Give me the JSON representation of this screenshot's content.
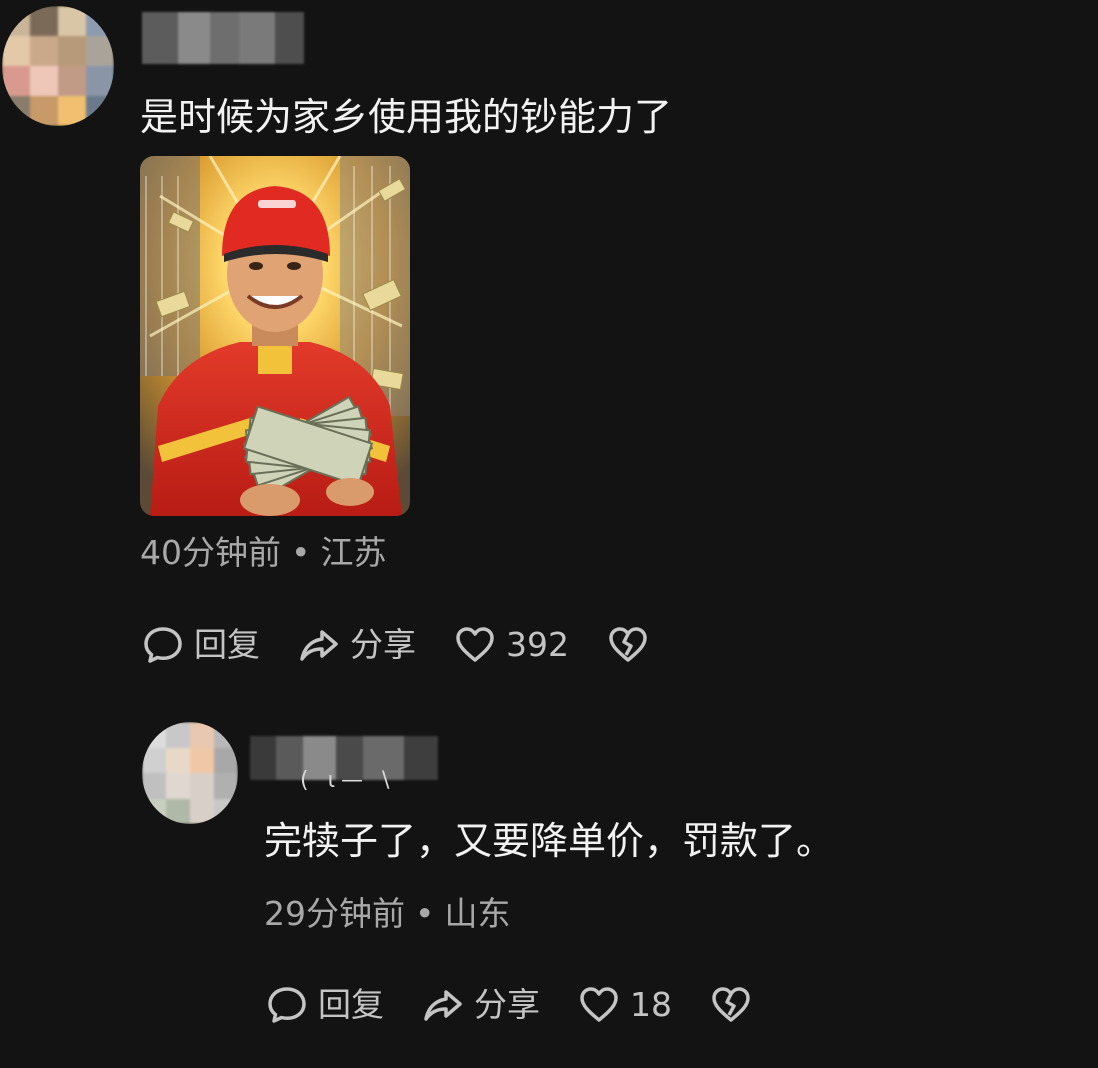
{
  "comments": [
    {
      "text": "是时候为家乡使用我的钞能力了",
      "time": "40分钟前",
      "location": "江苏",
      "actions": {
        "reply": "回复",
        "share": "分享",
        "likes": "392"
      },
      "attachment": {
        "icon": "photo-image",
        "description": "delivery rider in red helmet and uniform holding a fan of cash"
      },
      "avatar_colors": [
        "#c8b59a",
        "#7c6a58",
        "#d9c6a6",
        "#8c9bb0",
        "#e3c9a8",
        "#c9a98a",
        "#b79a7a",
        "#a9a39a",
        "#d89a8e",
        "#efc7b9",
        "#c29b86",
        "#8a96a8",
        "#8a7c6a",
        "#c79a68",
        "#f0c070",
        "#6a7a8c"
      ]
    },
    {
      "text": "完犊子了，又要降单价，罚款了。",
      "time": "29分钟前",
      "location": "山东",
      "actions": {
        "reply": "回复",
        "share": "分享",
        "likes": "18"
      },
      "avatar_colors": [
        "#dcdcdc",
        "#c8c8c8",
        "#e8c8b0",
        "#b8b8b8",
        "#d0d0d0",
        "#e8d8c8",
        "#f0c8a8",
        "#a8a8a8",
        "#c0c0c0",
        "#e0d8d0",
        "#d8d0c8",
        "#b0b0b0",
        "#c8d0c0",
        "#b0b8a8",
        "#d8d0c8",
        "#c8c8c8"
      ]
    }
  ],
  "colors": {
    "background": "#131313",
    "meta_text": "#a8a8a8",
    "action_text": "#c4c4c4"
  }
}
